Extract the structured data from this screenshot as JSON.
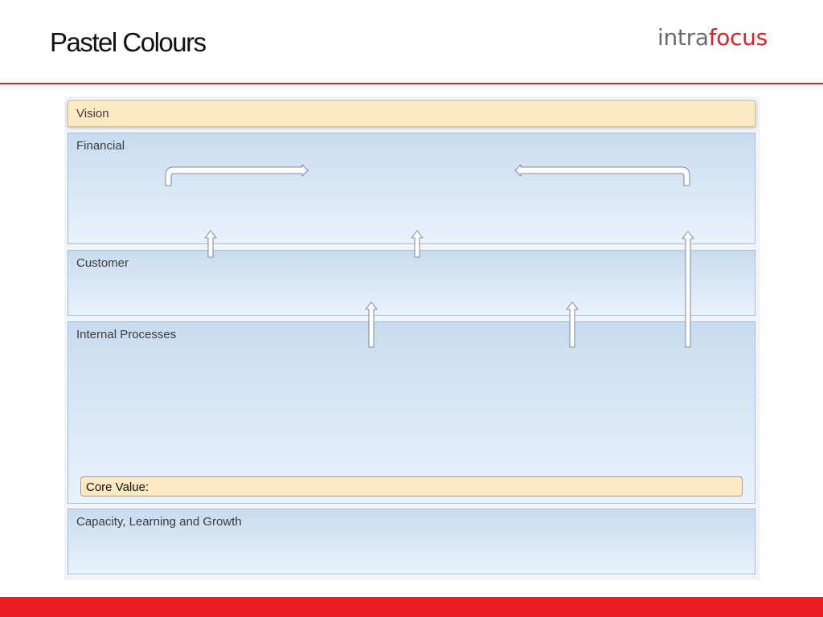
{
  "slide": {
    "title": "Pastel Colours"
  },
  "logo": {
    "part1": "intra",
    "part2": "focus"
  },
  "bands": {
    "vision": "Vision",
    "financial": "Financial",
    "customer": "Customer",
    "internal": "Internal Processes",
    "core_value": "Core Value:",
    "capacity": "Capacity, Learning and Growth"
  },
  "colors": {
    "accent_red": "#ee1d23",
    "rule_red": "#d6262d",
    "band_top": "#c8dcef",
    "band_bottom": "#e9f2fc",
    "vision_fill": "#fde9c2"
  }
}
